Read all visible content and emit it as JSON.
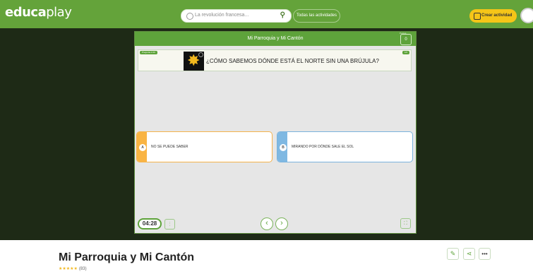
{
  "header": {
    "logo_bold": "educa",
    "logo_light": "play",
    "search_placeholder": "La revolución francesa...",
    "all_activities": "Todas las actividades",
    "create_activity": "Crear actividad"
  },
  "game": {
    "title": "Mi Parroquia y Mi Cantón",
    "score_label": "Puntos",
    "score_value": "0",
    "question_tag": "Pregunta 1/10",
    "question_number": "1/2",
    "question_text": "¿CÓMO SABEMOS DÓNDE ESTÁ EL NORTE SIN UNA BRÚJULA?",
    "answers": [
      {
        "letter": "A",
        "text": "NO SE PUEDE SABER",
        "color": "#f9b443"
      },
      {
        "letter": "B",
        "text": "MIRANDO POR DÓNDE SALE EL SOL",
        "color": "#7fb8e2"
      }
    ],
    "timer": "04:28",
    "prev_icon": "chevron-left-icon",
    "next_icon": "chevron-right-icon"
  },
  "activity": {
    "title": "Mi Parroquia y Mi Cantón",
    "stars": "★★★★★",
    "rating_count": "(83)"
  },
  "colors": {
    "brand_green": "#64a33a",
    "stage_bg": "#1e2a16",
    "create_yellow": "#f5c518"
  }
}
